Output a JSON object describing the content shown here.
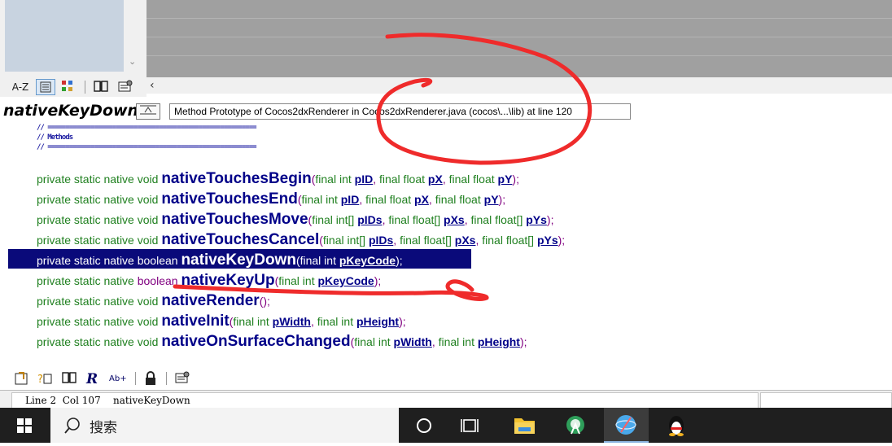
{
  "symbol_window": {
    "toolbar": {
      "az_label": "A-Z"
    },
    "symbol_name": "nativeKeyDown",
    "symbol_info": "Method Prototype of Cocos2dxRenderer in Cocos2dxRenderer.java (cocos\\...\\lib) at line 120"
  },
  "code": {
    "comment_lines": [
      "// ==========================================================",
      "// Methods",
      "// =========================================================="
    ],
    "lines": [
      {
        "mods": "private static native ",
        "ret": "void",
        "name": "nativeTouchesBegin",
        "open": "(",
        "params": [
          {
            "type": "final int ",
            "name": "pID"
          },
          {
            "type": "final float ",
            "name": "pX"
          },
          {
            "type": "final float ",
            "name": "pY"
          }
        ],
        "close": ");"
      },
      {
        "mods": "private static native ",
        "ret": "void",
        "name": "nativeTouchesEnd",
        "open": "(",
        "params": [
          {
            "type": "final int ",
            "name": "pID"
          },
          {
            "type": "final float ",
            "name": "pX"
          },
          {
            "type": "final float ",
            "name": "pY"
          }
        ],
        "close": ");"
      },
      {
        "mods": "private static native ",
        "ret": "void",
        "name": "nativeTouchesMove",
        "open": "(",
        "params": [
          {
            "type": "final int[] ",
            "name": "pIDs"
          },
          {
            "type": "final float[] ",
            "name": "pXs"
          },
          {
            "type": "final float[] ",
            "name": "pYs"
          }
        ],
        "close": ");"
      },
      {
        "mods": "private static native ",
        "ret": "void",
        "name": "nativeTouchesCancel",
        "open": "(",
        "params": [
          {
            "type": "final int[] ",
            "name": "pIDs"
          },
          {
            "type": "final float[] ",
            "name": "pXs"
          },
          {
            "type": "final float[] ",
            "name": "pYs"
          }
        ],
        "close": ");"
      },
      {
        "mods": "private static native ",
        "ret": "boolean",
        "name": "nativeKeyDown",
        "open": "(",
        "params": [
          {
            "type": "final int ",
            "name": "pKeyCode"
          }
        ],
        "close": ");"
      },
      {
        "mods": "private static native ",
        "ret": "boolean",
        "name": "nativeKeyUp",
        "open": "(",
        "params": [
          {
            "type": "final int ",
            "name": "pKeyCode"
          }
        ],
        "close": ");"
      },
      {
        "mods": "private static native ",
        "ret": "void",
        "name": "nativeRender",
        "open": "(",
        "params": [],
        "close": ");"
      },
      {
        "mods": "private static native ",
        "ret": "void",
        "name": "nativeInit",
        "open": "(",
        "params": [
          {
            "type": "final int ",
            "name": "pWidth"
          },
          {
            "type": "final int ",
            "name": "pHeight"
          }
        ],
        "close": ");"
      },
      {
        "mods": "private static native ",
        "ret": "void",
        "name": "nativeOnSurfaceChanged",
        "open": "(",
        "params": [
          {
            "type": "final int ",
            "name": "pWidth"
          },
          {
            "type": "final int ",
            "name": "pHeight"
          }
        ],
        "close": ");"
      }
    ],
    "selected_line_index": 4
  },
  "status_bar": {
    "line": "Line 2",
    "col": "Col 107",
    "symbol": "nativeKeyDown"
  },
  "taskbar": {
    "search_placeholder": "搜索",
    "apps": [
      "task-view",
      "file-explorer",
      "android-studio",
      "browser",
      "qq"
    ]
  },
  "colors": {
    "keyword_green": "#208020",
    "function_navy": "#000088",
    "boolean_purple": "#800080",
    "selection_navy": "#0a0a7a",
    "annotation_red": "#ef2b2b"
  }
}
